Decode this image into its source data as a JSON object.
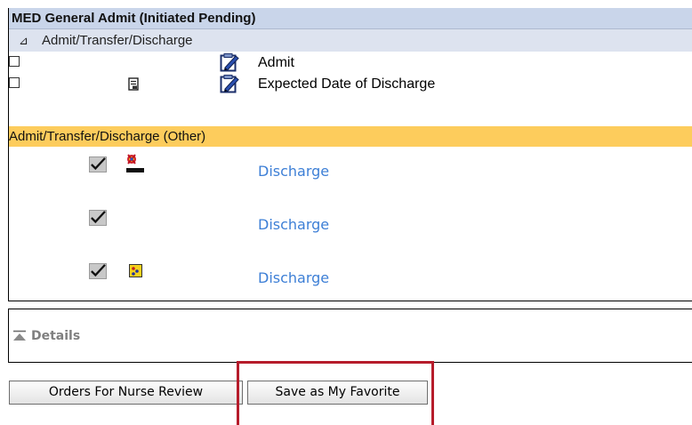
{
  "order_panel": {
    "title": "MED General Admit (Initiated Pending)",
    "section": {
      "toggle_glyph": "⊿",
      "label": "Admit/Transfer/Discharge"
    },
    "rows": [
      {
        "label": "Admit",
        "checked": false,
        "icons": [
          "order-sentence-icon"
        ]
      },
      {
        "label": "Expected Date of Discharge",
        "checked": false,
        "icons": [
          "note-icon",
          "order-sentence-icon"
        ]
      }
    ],
    "other_section": {
      "label": "Admit/Transfer/Discharge (Other)"
    },
    "discharge_rows": [
      {
        "label": "Discharge",
        "checked": true,
        "icon": "discharge-logo-icon"
      },
      {
        "label": "Discharge",
        "checked": true,
        "icon": ""
      },
      {
        "label": "Discharge",
        "checked": true,
        "icon": "yellow-order-icon"
      }
    ]
  },
  "details": {
    "label": "Details",
    "icon": "collapse-up-icon"
  },
  "buttons": {
    "nurse_review": "Orders For Nurse Review",
    "save_favorite": "Save as My Favorite"
  },
  "colors": {
    "title_bar": "#c9d5ea",
    "section_bar": "#dde3ef",
    "other_bar": "#fdcc5c",
    "link": "#3d7fd6",
    "highlight": "#b61c2b"
  }
}
